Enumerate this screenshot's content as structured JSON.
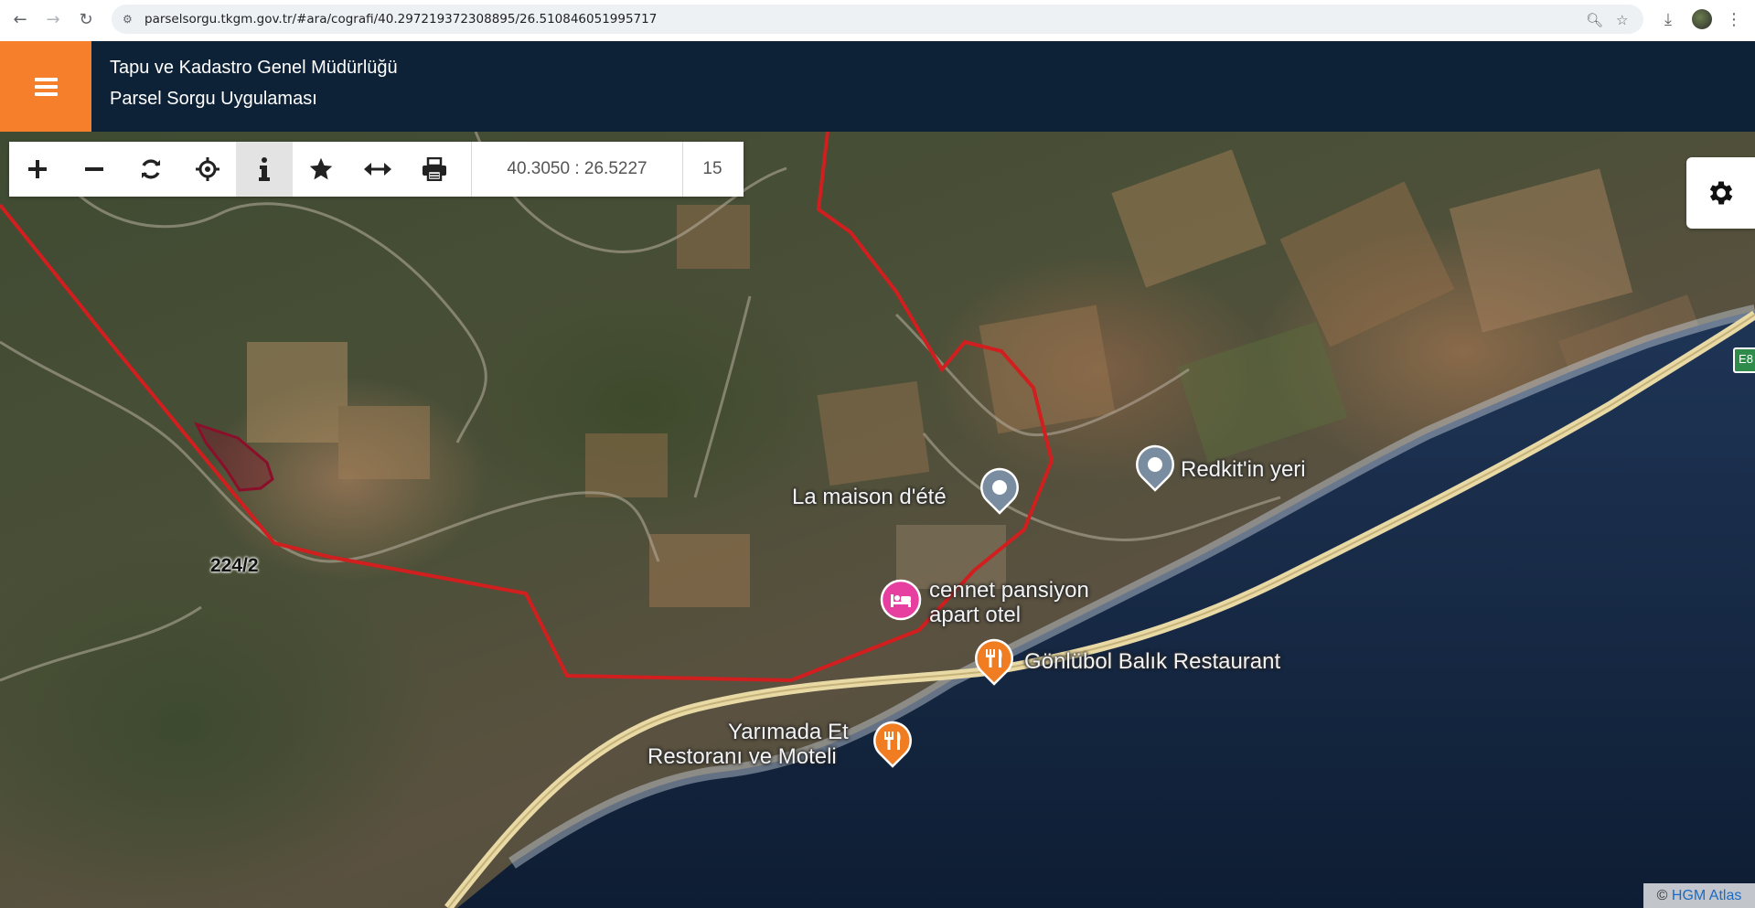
{
  "browser": {
    "url": "parselsorgu.tkgm.gov.tr/#ara/cografi/40.297219372308895/26.510846051995717",
    "back_icon": "←",
    "forward_icon": "→",
    "reload_icon": "↻"
  },
  "header": {
    "title_line1": "Tapu ve Kadastro Genel Müdürlüğü",
    "title_line2": "Parsel Sorgu Uygulaması",
    "accent_color": "#f57f2a",
    "background_color": "#0e2237"
  },
  "toolbar": {
    "coordinates": "40.3050 : 26.5227",
    "zoom_level": "15",
    "buttons": [
      "zoom-in",
      "zoom-out",
      "refresh",
      "locate",
      "info",
      "favorites",
      "measure",
      "print"
    ],
    "active_button": "info"
  },
  "map": {
    "parcel_label": "224/2",
    "pois": [
      {
        "name": "Redkit'in yeri",
        "icon": "place-pin-icon"
      },
      {
        "name": "La maison d'été",
        "icon": "place-pin-icon"
      },
      {
        "name": "cennet pansiyon apart otel",
        "line1": "cennet pansiyon",
        "line2": "apart otel",
        "icon": "hotel-bed-icon"
      },
      {
        "name": "Gönlübol Balık Restaurant",
        "icon": "restaurant-icon"
      },
      {
        "name": "Yarımada Et Restoranı ve Moteli",
        "line1": "Yarımada Et",
        "line2": "Restoranı ve Moteli",
        "icon": "restaurant-icon"
      }
    ],
    "road_sign": "E8",
    "attribution_prefix": "©",
    "attribution_link": "HGM Atlas",
    "boundary_color": "#d11e1e",
    "parcel_color": "#8b0f2a"
  }
}
